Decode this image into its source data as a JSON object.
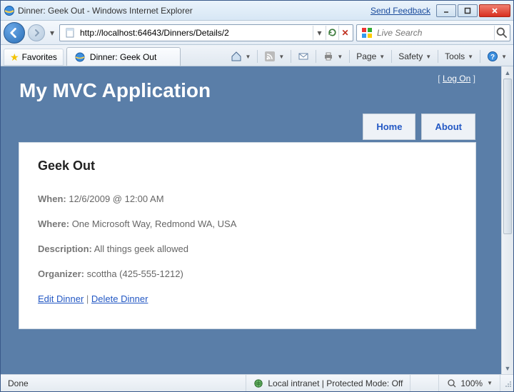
{
  "window": {
    "title": "Dinner: Geek Out - Windows Internet Explorer",
    "feedback": "Send Feedback"
  },
  "address": {
    "url": "http://localhost:64643/Dinners/Details/2"
  },
  "search": {
    "placeholder": "Live Search"
  },
  "favorites": {
    "label": "Favorites"
  },
  "tab": {
    "title": "Dinner: Geek Out"
  },
  "toolbar": {
    "page": "Page",
    "safety": "Safety",
    "tools": "Tools"
  },
  "app": {
    "title": "My MVC Application",
    "logon_bracket_open": "[ ",
    "logon": "Log On",
    "logon_bracket_close": " ]",
    "nav": {
      "home": "Home",
      "about": "About"
    }
  },
  "dinner": {
    "heading": "Geek Out",
    "when_label": "When:",
    "when_value": "12/6/2009 @ 12:00 AM",
    "where_label": "Where:",
    "where_value": "One Microsoft Way, Redmond WA, USA",
    "desc_label": "Description:",
    "desc_value": "All things geek allowed",
    "org_label": "Organizer:",
    "org_value": "scottha (425-555-1212)",
    "edit": "Edit Dinner",
    "sep": " | ",
    "delete": "Delete Dinner"
  },
  "status": {
    "left": "Done",
    "zone": "Local intranet | Protected Mode: Off",
    "zoom": "100%"
  }
}
